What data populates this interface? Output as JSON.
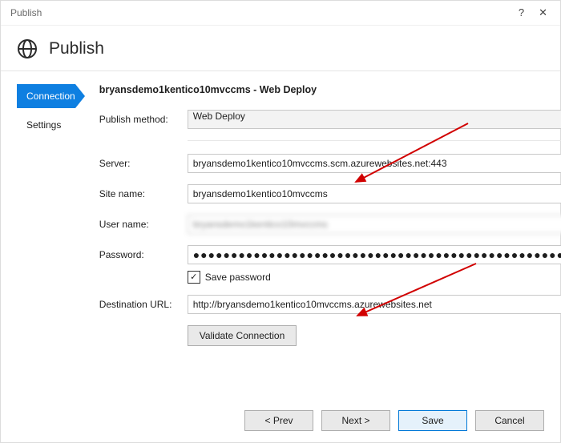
{
  "window": {
    "title": "Publish",
    "help_glyph": "?",
    "close_glyph": "✕"
  },
  "header": {
    "title": "Publish"
  },
  "sidebar": {
    "items": [
      {
        "label": "Connection"
      },
      {
        "label": "Settings"
      }
    ]
  },
  "form": {
    "title": "bryansdemo1kentico10mvccms - Web Deploy",
    "publish_method_label": "Publish method:",
    "publish_method_value": "Web Deploy",
    "server_label": "Server:",
    "server_value": "bryansdemo1kentico10mvccms.scm.azurewebsites.net:443",
    "site_name_label": "Site name:",
    "site_name_value": "bryansdemo1kentico10mvccms",
    "user_name_label": "User name:",
    "user_name_value": "bryansdemo1kentico10mvccms",
    "password_label": "Password:",
    "password_value": "●●●●●●●●●●●●●●●●●●●●●●●●●●●●●●●●●●●●●●●●●●●●●●●●●●●●●●●●",
    "save_password_label": "Save password",
    "save_password_checked": "✓",
    "destination_url_label": "Destination URL:",
    "destination_url_value": "http://bryansdemo1kentico10mvccms.azurewebsites.net",
    "validate_label": "Validate Connection"
  },
  "buttons": {
    "prev": "< Prev",
    "next": "Next >",
    "save": "Save",
    "cancel": "Cancel"
  }
}
